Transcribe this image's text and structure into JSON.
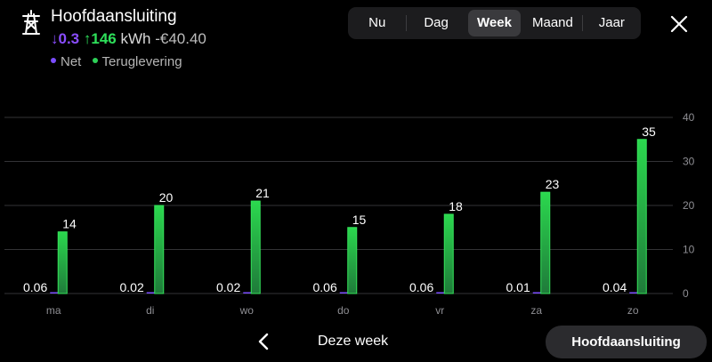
{
  "header": {
    "title": "Hoofdaansluiting",
    "net_value": "0.3",
    "return_value": "146",
    "unit": "kWh",
    "cost": "-€40.40",
    "legend": [
      {
        "label": "Net",
        "color": "#7b4dff"
      },
      {
        "label": "Teruglevering",
        "color": "#2ed158"
      }
    ]
  },
  "tabs": [
    {
      "label": "Nu",
      "active": false
    },
    {
      "label": "Dag",
      "active": false
    },
    {
      "label": "Week",
      "active": true
    },
    {
      "label": "Maand",
      "active": false
    },
    {
      "label": "Jaar",
      "active": false
    }
  ],
  "footer": {
    "period_label": "Deze week",
    "meter_button": "Hoofdaansluiting"
  },
  "chart_data": {
    "type": "bar",
    "categories": [
      "ma",
      "di",
      "wo",
      "do",
      "vr",
      "za",
      "zo"
    ],
    "series": [
      {
        "name": "Net",
        "values": [
          0.06,
          0.02,
          0.02,
          0.06,
          0.06,
          0.01,
          0.04
        ],
        "color": "#7b4dff"
      },
      {
        "name": "Teruglevering",
        "values": [
          14,
          20,
          21,
          15,
          18,
          23,
          35
        ],
        "color": "#2ed158"
      }
    ],
    "y_ticks": [
      "0",
      "10",
      "20",
      "30",
      "40"
    ],
    "ylim": [
      0,
      40
    ],
    "grid": true,
    "axis_side": "right"
  }
}
